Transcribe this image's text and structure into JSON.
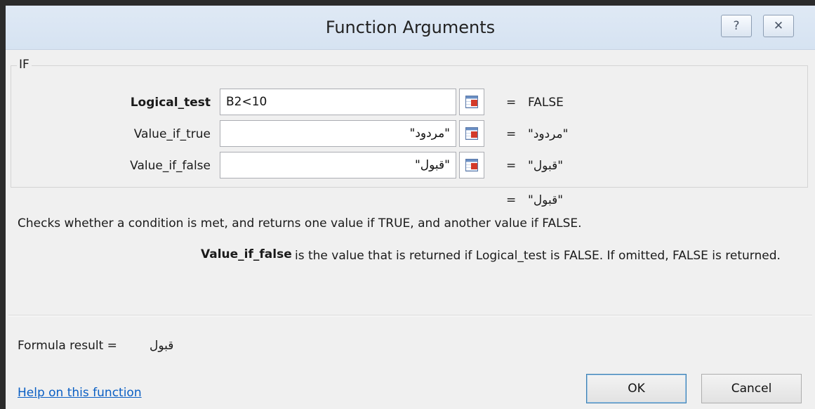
{
  "window": {
    "title": "Function Arguments",
    "help_button": "?",
    "close_button": "✕"
  },
  "function_group": {
    "label": "IF",
    "arguments": [
      {
        "name": "Logical_test",
        "value": "B2<10",
        "result": "FALSE"
      },
      {
        "name": "Value_if_true",
        "value": "\"مردود\"",
        "result": "\"مردود\""
      },
      {
        "name": "Value_if_false",
        "value": "\"قبول\"",
        "result": "\"قبول\""
      }
    ],
    "equals": "="
  },
  "overall_result": "\"قبول\"",
  "description": "Checks whether a condition is met, and returns one value if TRUE, and another value if FALSE.",
  "argument_help": {
    "name": "Value_if_false",
    "text": "is the value that is returned if Logical_test is FALSE. If omitted, FALSE is returned."
  },
  "formula_result": {
    "label": "Formula result =",
    "value": "قبول"
  },
  "footer": {
    "help_link": "Help on this function",
    "ok": "OK",
    "cancel": "Cancel"
  },
  "colors": {
    "titlebar": "#d6e3f2",
    "link": "#0a5fc4",
    "ok_border": "#3c7fb1"
  }
}
